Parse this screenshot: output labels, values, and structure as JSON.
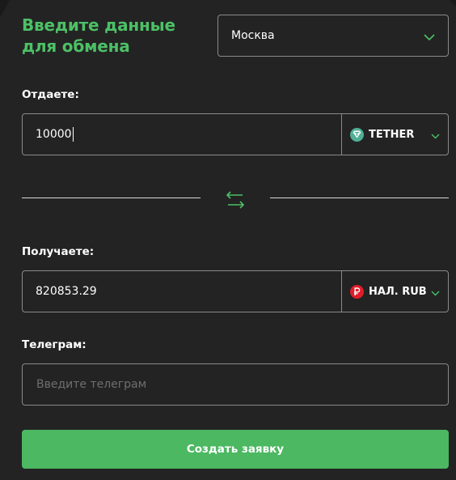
{
  "header": {
    "title_line1": "Введите данные",
    "title_line2": "для обмена"
  },
  "city": {
    "selected": "Москва"
  },
  "give": {
    "label": "Отдаете:",
    "amount": "10000",
    "currency": "TETHER",
    "currency_icon": "tether-icon"
  },
  "receive": {
    "label": "Получаете:",
    "amount": "820853.29",
    "currency": "НАЛ. RUB",
    "currency_icon": "ruble-icon"
  },
  "telegram": {
    "label": "Телеграм:",
    "value": "",
    "placeholder": "Введите телеграм"
  },
  "submit": {
    "label": "Создать заявку"
  },
  "colors": {
    "accent": "#4cc066",
    "button": "#4cb862",
    "tether": "#50af95",
    "ruble": "#e11d2a",
    "background": "#232323",
    "border": "#8a8a8a"
  }
}
